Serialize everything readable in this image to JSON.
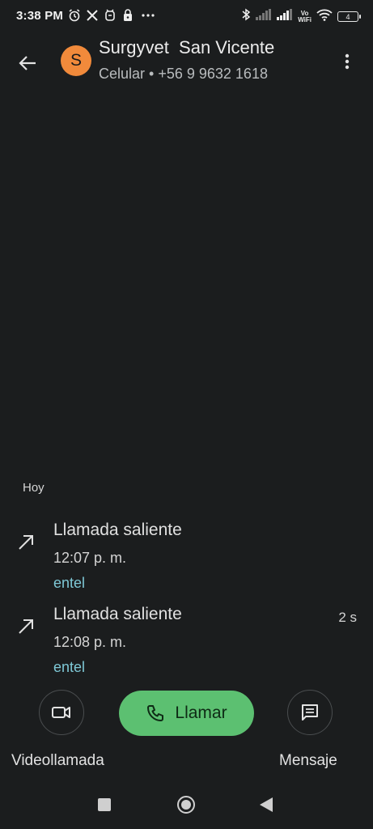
{
  "status_bar": {
    "time": "3:38 PM",
    "battery_level": "4",
    "volte_line1": "Vo",
    "volte_line2": "WiFi",
    "icons": [
      "alarm-icon",
      "x-icon",
      "mi-fitness-icon",
      "lock-icon",
      "more-dots-icon",
      "bluetooth-icon",
      "signal-icon",
      "signal-icon",
      "vowifi-icon",
      "wifi-icon",
      "battery-icon"
    ]
  },
  "header": {
    "avatar_letter": "S",
    "avatar_color": "#f18a3b",
    "contact_name": "Surgyvet  San Vicente",
    "contact_subtitle": "Celular • +56 9 9632 1618"
  },
  "history": {
    "section_label": "Hoy",
    "calls": [
      {
        "type": "Llamada saliente",
        "time": "12:07 p. m.",
        "carrier": "entel",
        "duration": ""
      },
      {
        "type": "Llamada saliente",
        "time": "12:08 p. m.",
        "carrier": "entel",
        "duration": "2 s"
      }
    ]
  },
  "actions": {
    "video_label": "Videollamada",
    "call_label": "Llamar",
    "message_label": "Mensaje",
    "call_color": "#5cc071"
  },
  "colors": {
    "background": "#1b1d1e",
    "carrier_text": "#7ec8d6"
  }
}
